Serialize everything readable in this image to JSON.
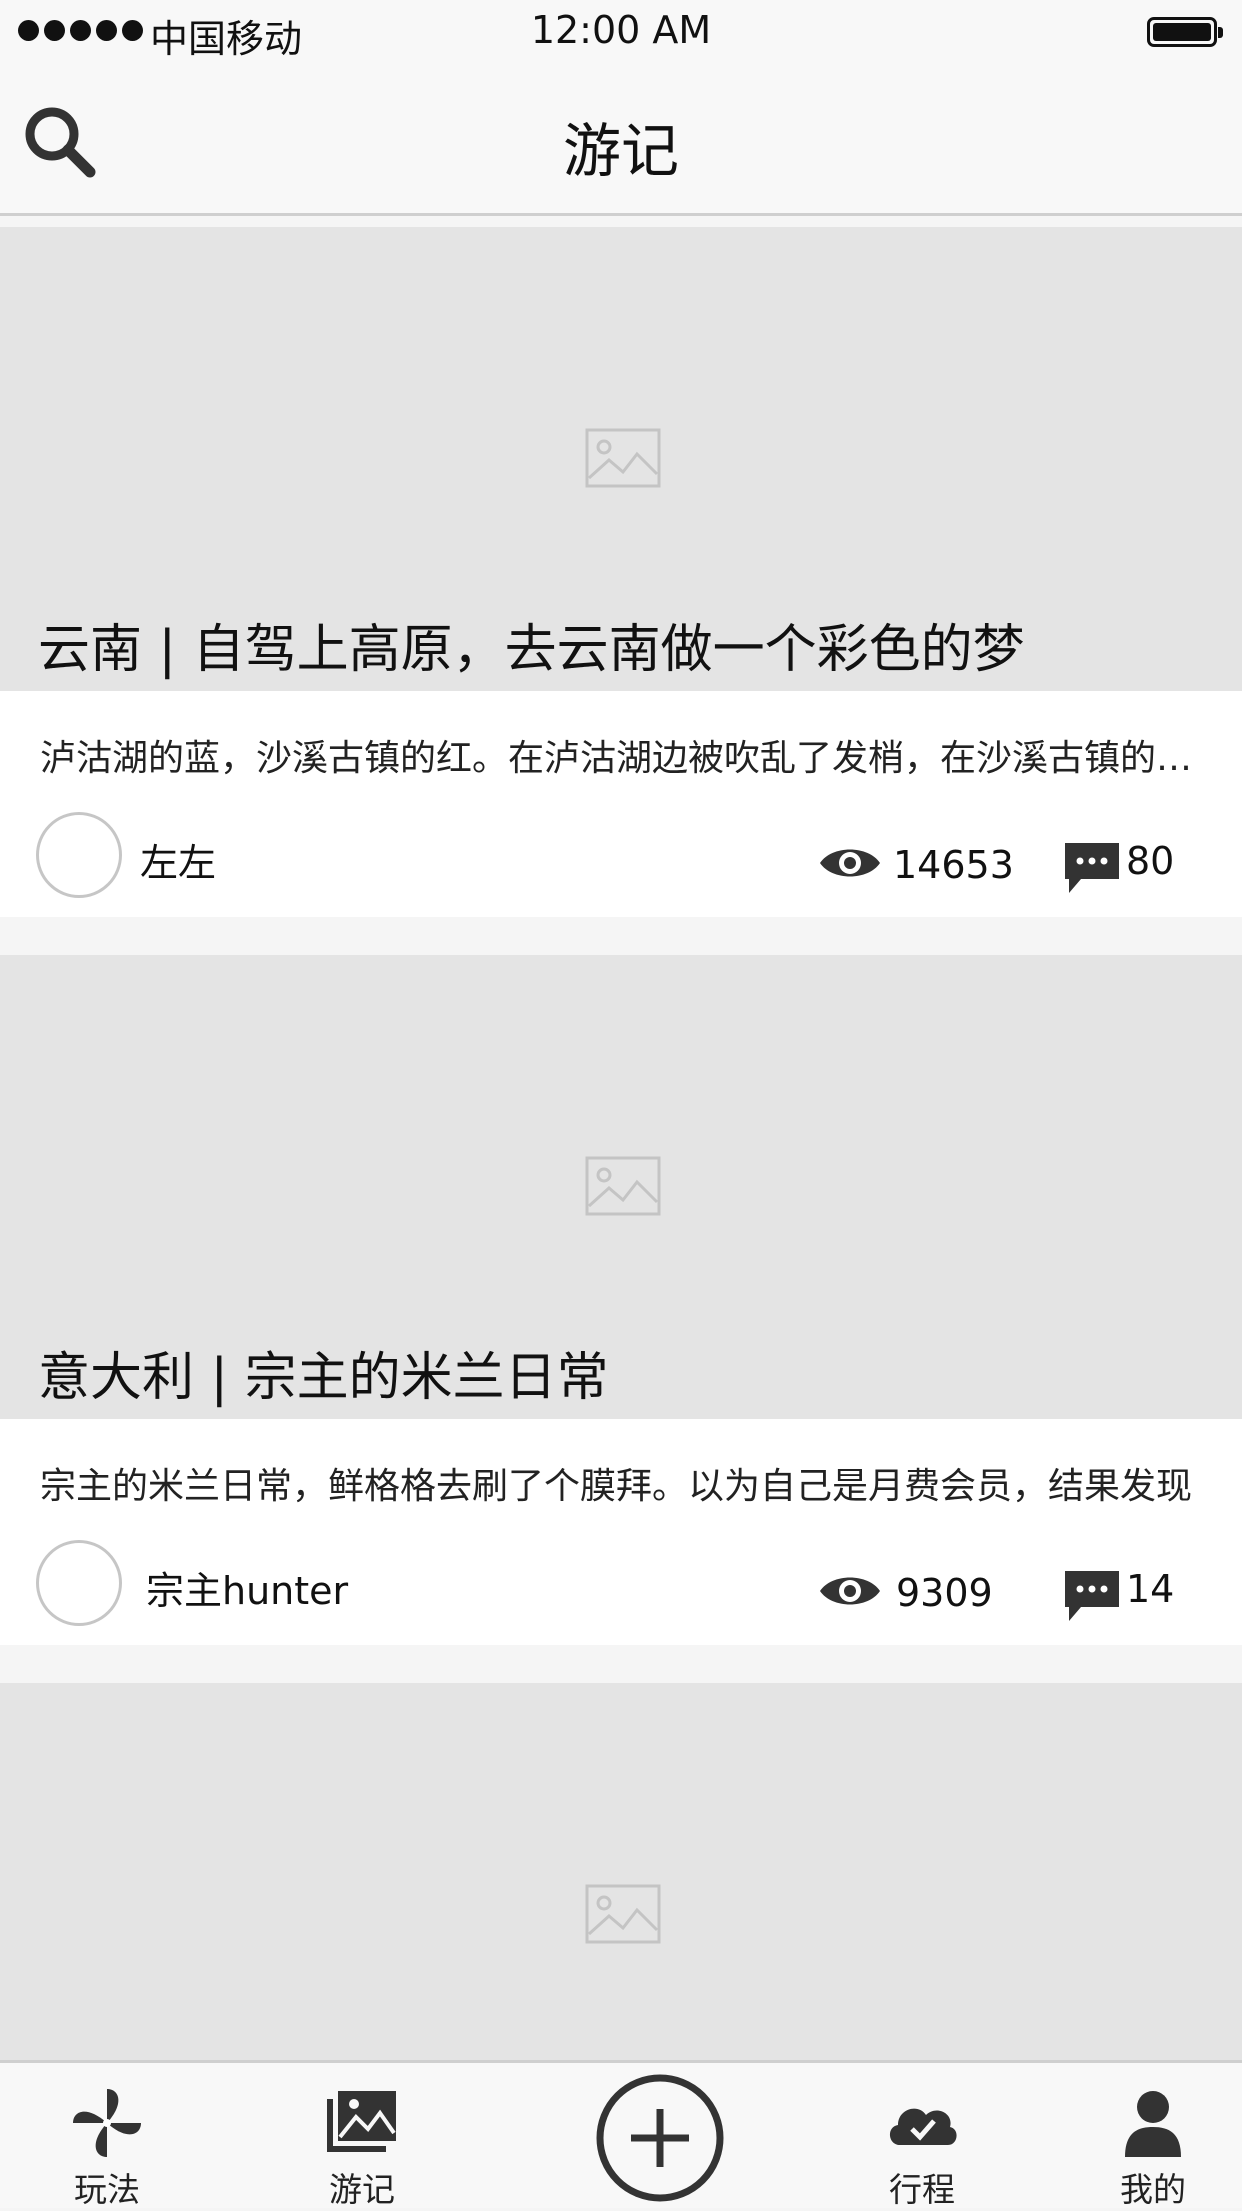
{
  "status_bar": {
    "carrier": "中国移动",
    "time": "12:00 AM"
  },
  "nav": {
    "title": "游记"
  },
  "posts": [
    {
      "title": "云南 | 自驾上高原，去云南做一个彩色的梦",
      "excerpt": "泸沽湖的蓝，沙溪古镇的红。在泸沽湖边被吹乱了发梢，在沙溪古镇的红墙下",
      "author": "左左",
      "views": "14653",
      "comments": "80"
    },
    {
      "title": "意大利 | 宗主的米兰日常",
      "excerpt": "宗主的米兰日常，鲜格格去刷了个膜拜。以为自己是月费会员，结果发现",
      "author": "宗主hunter",
      "views": "9309",
      "comments": "14"
    }
  ],
  "tabs": [
    {
      "label": "玩法",
      "icon": "pinwheel-icon"
    },
    {
      "label": "游记",
      "icon": "photo-album-icon"
    },
    {
      "label": "",
      "icon": "add-circle-icon"
    },
    {
      "label": "行程",
      "icon": "cloud-check-icon"
    },
    {
      "label": "我的",
      "icon": "user-icon"
    }
  ]
}
